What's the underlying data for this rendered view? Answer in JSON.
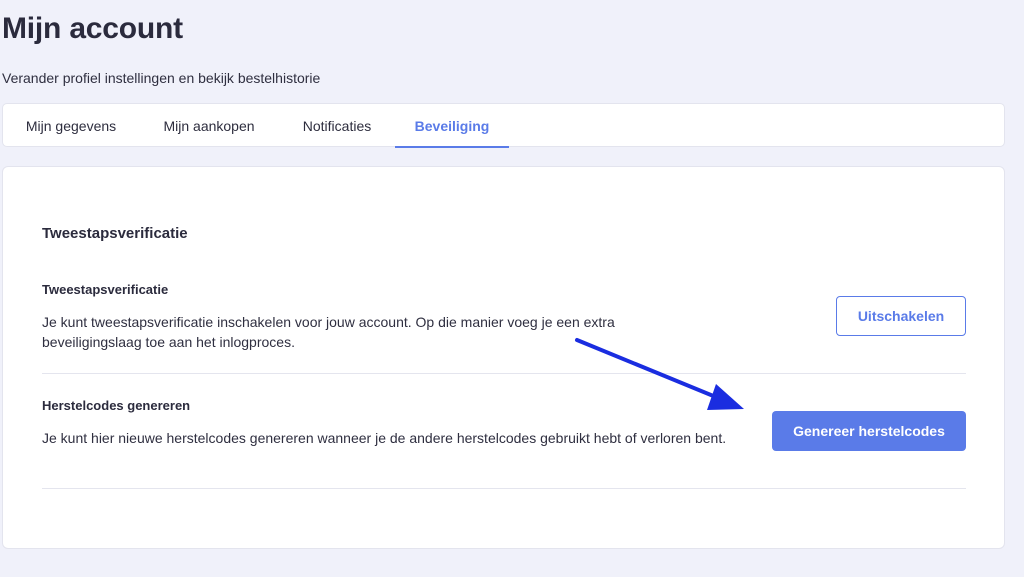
{
  "header": {
    "title": "Mijn account",
    "subtitle": "Verander profiel instellingen en bekijk bestelhistorie"
  },
  "tabs": [
    {
      "label": "Mijn gegevens",
      "active": false
    },
    {
      "label": "Mijn aankopen",
      "active": false
    },
    {
      "label": "Notificaties",
      "active": false
    },
    {
      "label": "Beveiliging",
      "active": true
    }
  ],
  "security": {
    "section_title": "Tweestapsverificatie",
    "two_factor": {
      "title": "Tweestapsverificatie",
      "description": "Je kunt tweestapsverificatie inschakelen voor jouw account. Op die manier voeg je een extra beveiligingslaag toe aan het inlogproces.",
      "button_label": "Uitschakelen"
    },
    "recovery_codes": {
      "title": "Herstelcodes genereren",
      "description": "Je kunt hier nieuwe herstelcodes genereren wanneer je de andere herstelcodes gebruikt hebt of verloren bent.",
      "button_label": "Genereer herstelcodes"
    }
  },
  "annotation": {
    "arrow_color": "#1a2de0"
  },
  "colors": {
    "accent": "#5a7be8",
    "background": "#f0f1fa"
  }
}
